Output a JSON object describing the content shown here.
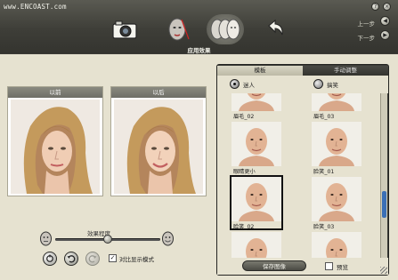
{
  "header": {
    "site_logo": "www.ENCOAST.com",
    "help_icon": "help-icon",
    "close_icon": "close-icon",
    "tools": [
      "camera-icon",
      "face-edit-icon",
      "face-morph-icon",
      "undo-arrow-icon"
    ],
    "prev_label": "上一步",
    "next_label": "下一步",
    "section_title": "应用效果"
  },
  "compare": {
    "before_label": "以前",
    "after_label": "以后"
  },
  "controls": {
    "effect_label": "效果程度",
    "slider_value": 0.5,
    "compare_checkbox_label": "对比显示模式",
    "compare_checked": true
  },
  "right_panel": {
    "tabs": [
      "模板",
      "手动调整"
    ],
    "active_tab": 0,
    "radio_options": [
      "迷人",
      "搞笑"
    ],
    "selected_radio": 0,
    "thumbnails": [
      {
        "label": "眉毛_02"
      },
      {
        "label": "眉毛_03"
      },
      {
        "label": "眼睛更小"
      },
      {
        "label": "脸笑_01"
      },
      {
        "label": "脸笑_02",
        "selected": true
      },
      {
        "label": "脸笑_03"
      },
      {
        "label": ""
      },
      {
        "label": ""
      }
    ],
    "save_button_label": "保存图像",
    "preview_label": "预览",
    "preview_checked": false
  },
  "colors": {
    "topbar": "#3e3e38",
    "panel_bg": "#e6e2d0",
    "accent": "#3b6fb6"
  }
}
